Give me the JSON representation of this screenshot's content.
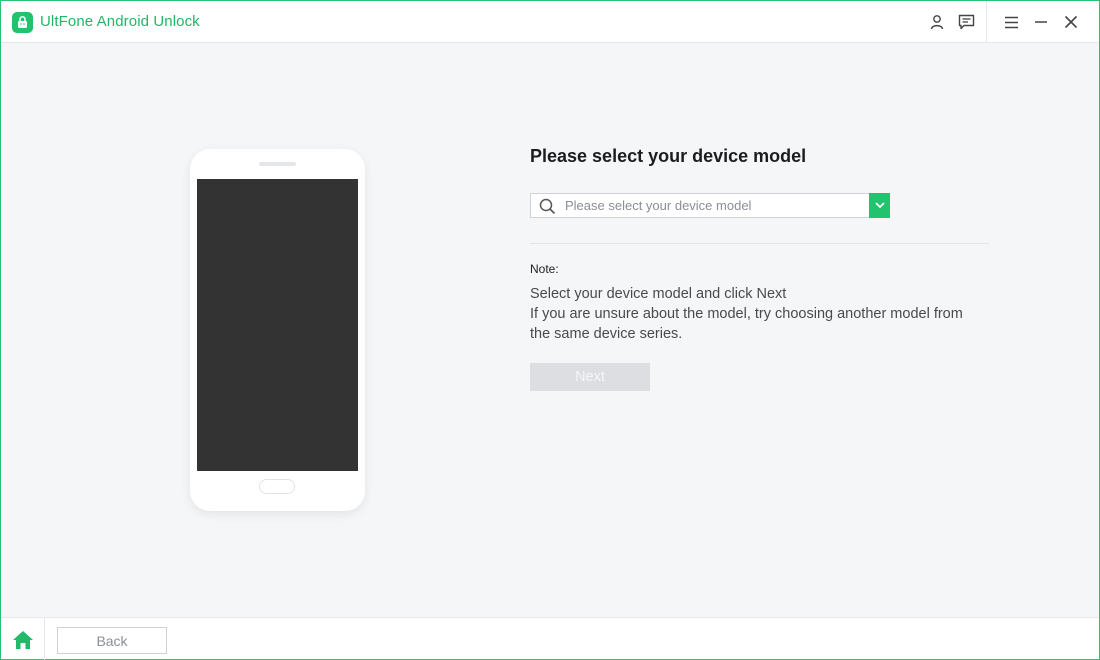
{
  "app": {
    "title": "UltFone Android Unlock",
    "logo_icon": "android-lock-icon",
    "accent_color": "#22c26e"
  },
  "titlebar": {
    "icons": [
      "user-icon",
      "feedback-icon",
      "menu-icon",
      "minimize-icon",
      "close-icon"
    ]
  },
  "main": {
    "title": "Please select your device model",
    "select": {
      "placeholder": "Please select your device model",
      "value": ""
    },
    "note_label": "Note:",
    "note_lines": [
      "Select your device model and click Next",
      "If you are unsure about the model, try choosing another model from",
      "the same device series."
    ],
    "next_label": "Next"
  },
  "bottombar": {
    "back_label": "Back"
  }
}
